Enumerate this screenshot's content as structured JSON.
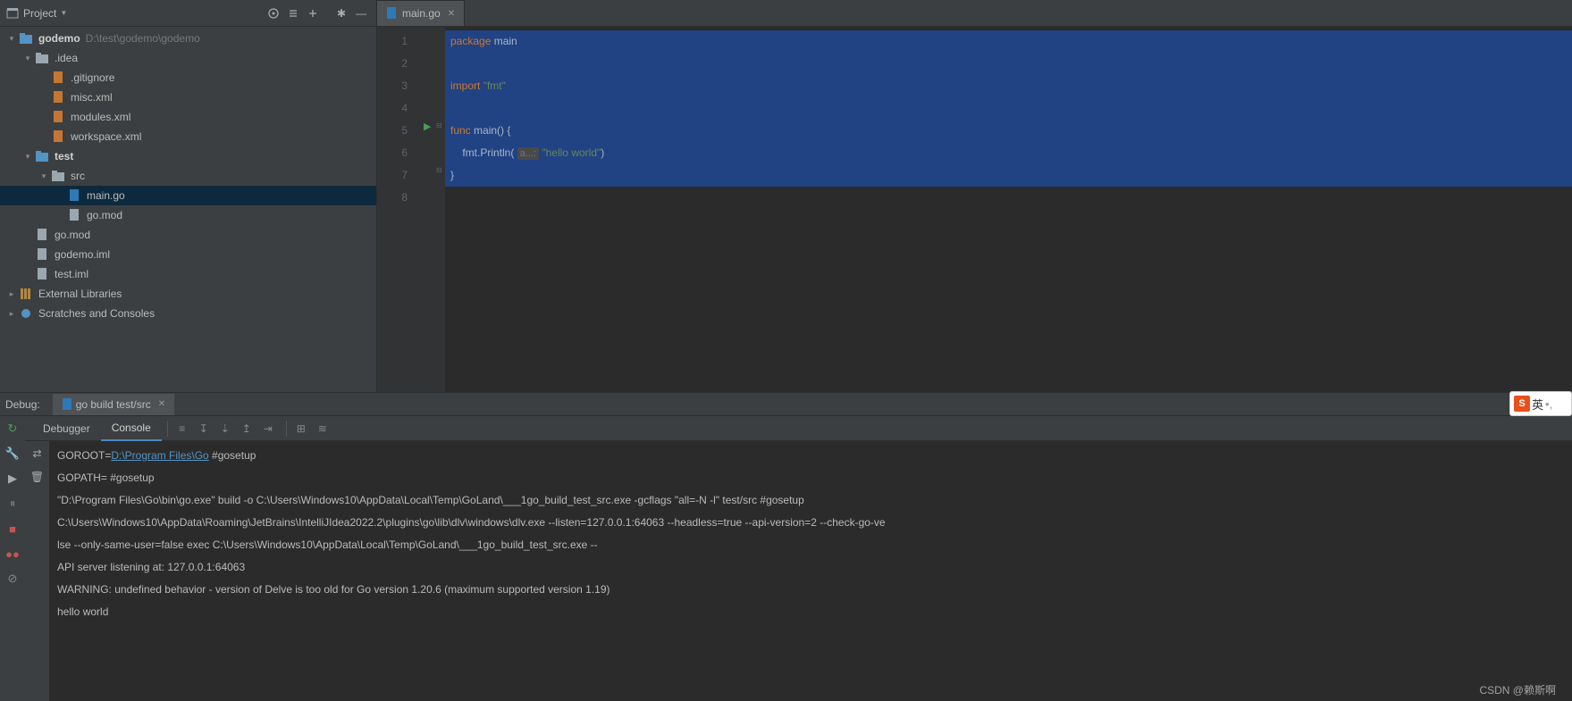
{
  "sidebar": {
    "title": "Project",
    "project_name": "godemo",
    "project_path": "D:\\test\\godemo\\godemo",
    "idea_folder": ".idea",
    "idea_files": [
      ".gitignore",
      "misc.xml",
      "modules.xml",
      "workspace.xml"
    ],
    "test_folder": "test",
    "src_folder": "src",
    "src_files": [
      "main.go",
      "go.mod"
    ],
    "root_files": [
      "go.mod",
      "godemo.iml",
      "test.iml"
    ],
    "ext_lib": "External Libraries",
    "scratches": "Scratches and Consoles"
  },
  "editor": {
    "tab_name": "main.go",
    "lines": [
      "1",
      "2",
      "3",
      "4",
      "5",
      "6",
      "7",
      "8"
    ],
    "code": {
      "l1_kw": "package",
      "l1_id": "main",
      "l3_kw": "import",
      "l3_str": "\"fmt\"",
      "l5_kw": "func",
      "l5_id": "main",
      "l5_rest": "() {",
      "l6_pre": "    fmt.Println( ",
      "l6_hint": "a...:",
      "l6_str": " \"hello world\"",
      "l6_end": ")",
      "l7": "}"
    }
  },
  "debug": {
    "title": "Debug:",
    "run_config": "go build test/src",
    "tabs": {
      "debugger": "Debugger",
      "console": "Console"
    },
    "console": {
      "l1_a": "GOROOT=",
      "l1_link": "D:\\Program Files\\Go",
      "l1_b": " #gosetup",
      "l2": "GOPATH= #gosetup",
      "l3": "\"D:\\Program Files\\Go\\bin\\go.exe\" build -o C:\\Users\\Windows10\\AppData\\Local\\Temp\\GoLand\\___1go_build_test_src.exe -gcflags \"all=-N -l\" test/src #gosetup",
      "l4": "C:\\Users\\Windows10\\AppData\\Roaming\\JetBrains\\IntelliJIdea2022.2\\plugins\\go\\lib\\dlv\\windows\\dlv.exe --listen=127.0.0.1:64063 --headless=true --api-version=2 --check-go-ve",
      "l5": "lse --only-same-user=false exec C:\\Users\\Windows10\\AppData\\Local\\Temp\\GoLand\\___1go_build_test_src.exe --",
      "l6": "API server listening at: 127.0.0.1:64063",
      "l7": "WARNING: undefined behavior - version of Delve is too old for Go version 1.20.6 (maximum supported version 1.19)",
      "l8": "hello world"
    }
  },
  "ime": {
    "logo": "S",
    "char": "英"
  },
  "watermark": "CSDN @赖斯啊"
}
